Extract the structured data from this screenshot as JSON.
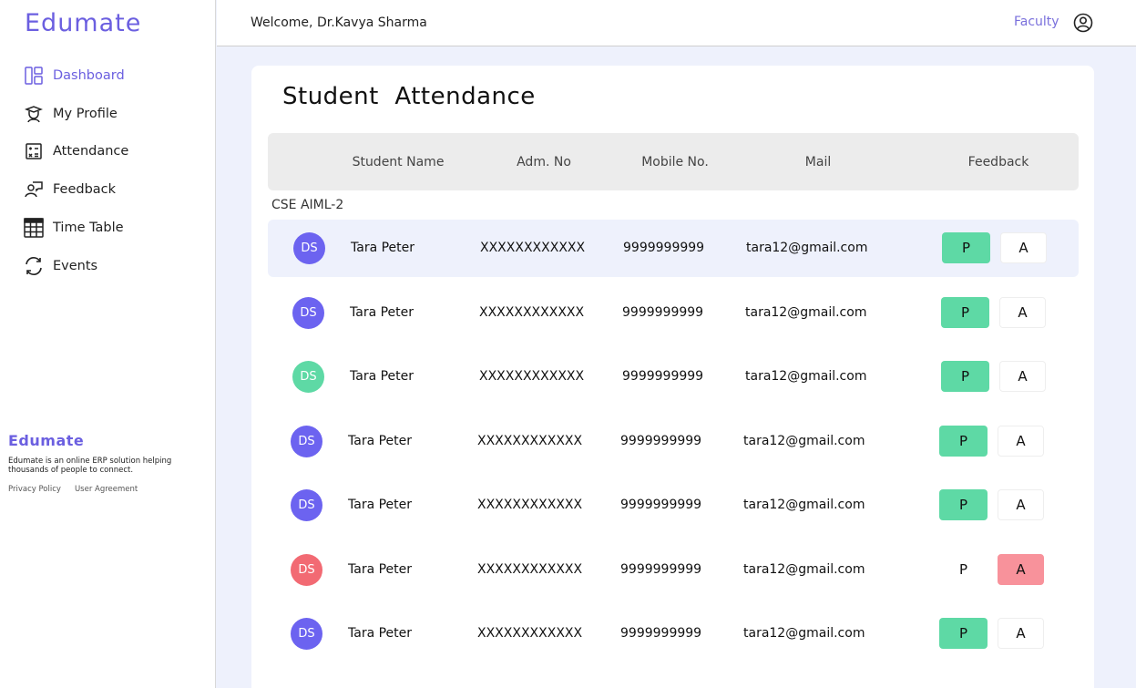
{
  "app": {
    "brand": "Edumate"
  },
  "sidebar": {
    "items": [
      {
        "label": "Dashboard",
        "icon": "dashboard-icon",
        "active": true
      },
      {
        "label": "My Profile",
        "icon": "profile-icon",
        "active": false
      },
      {
        "label": "Attendance",
        "icon": "attendance-icon",
        "active": false
      },
      {
        "label": "Feedback",
        "icon": "feedback-icon",
        "active": false
      },
      {
        "label": "Time Table",
        "icon": "timetable-icon",
        "active": false
      },
      {
        "label": "Events",
        "icon": "events-icon",
        "active": false
      }
    ],
    "footer": {
      "brand": "Edumate",
      "description": "Edumate is an online ERP solution helping thousands of people to connect.",
      "links": [
        "Privacy Policy",
        "User Agreement"
      ]
    }
  },
  "header": {
    "welcome": "Welcome, Dr.Kavya Sharma",
    "role": "Faculty",
    "user_icon": "user-circle-icon"
  },
  "main": {
    "title": "Student  Attendance",
    "columns": [
      "Student Name",
      "Adm. No",
      "Mobile No.",
      "Mail",
      "Feedback"
    ],
    "group": "CSE AIML-2",
    "present_label": "P",
    "absent_label": "A",
    "rows": [
      {
        "initials": "DS",
        "avatar_color": "#6c63f0",
        "name": "Tara Peter",
        "adm": "XXXXXXXXXXXX",
        "mobile": "9999999999",
        "mail": "tara12@gmail.com",
        "status": "P"
      },
      {
        "initials": "DS",
        "avatar_color": "#6c63f0",
        "name": "Tara Peter",
        "adm": "XXXXXXXXXXXX",
        "mobile": "9999999999",
        "mail": "tara12@gmail.com",
        "status": "P"
      },
      {
        "initials": "DS",
        "avatar_color": "#5ed9a5",
        "name": "Tara Peter",
        "adm": "XXXXXXXXXXXX",
        "mobile": "9999999999",
        "mail": "tara12@gmail.com",
        "status": "P"
      },
      {
        "initials": "DS",
        "avatar_color": "#6c63f0",
        "name": "Tara Peter",
        "adm": "XXXXXXXXXXXX",
        "mobile": "9999999999",
        "mail": "tara12@gmail.com",
        "status": "P"
      },
      {
        "initials": "DS",
        "avatar_color": "#6c63f0",
        "name": "Tara Peter",
        "adm": "XXXXXXXXXXXX",
        "mobile": "9999999999",
        "mail": "tara12@gmail.com",
        "status": "P"
      },
      {
        "initials": "DS",
        "avatar_color": "#f26a73",
        "name": "Tara Peter",
        "adm": "XXXXXXXXXXXX",
        "mobile": "9999999999",
        "mail": "tara12@gmail.com",
        "status": "A"
      },
      {
        "initials": "DS",
        "avatar_color": "#6c63f0",
        "name": "Tara Peter",
        "adm": "XXXXXXXXXXXX",
        "mobile": "9999999999",
        "mail": "tara12@gmail.com",
        "status": "P"
      }
    ]
  },
  "colors": {
    "accent": "#6b5fe0",
    "present": "#5ed9a5",
    "absent": "#f8929b",
    "background": "#eef1fc"
  }
}
